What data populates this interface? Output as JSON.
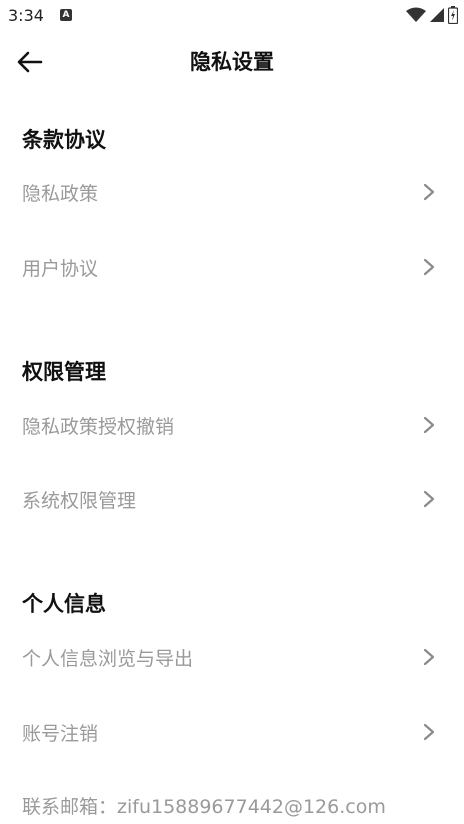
{
  "status_bar": {
    "time": "3:34",
    "notification_icon": "a-icon"
  },
  "header": {
    "title": "隐私设置",
    "back_icon": "arrow-left-icon"
  },
  "sections": [
    {
      "title": "条款协议",
      "items": [
        {
          "label": "隐私政策"
        },
        {
          "label": "用户协议"
        }
      ]
    },
    {
      "title": "权限管理",
      "items": [
        {
          "label": "隐私政策授权撤销"
        },
        {
          "label": "系统权限管理"
        }
      ]
    },
    {
      "title": "个人信息",
      "items": [
        {
          "label": "个人信息浏览与导出"
        },
        {
          "label": "账号注销"
        }
      ]
    }
  ],
  "contact": {
    "text": "联系邮箱：zifu15889677442@126.com"
  },
  "colors": {
    "title": "#111111",
    "item_text": "#9a9a9a",
    "chevron": "#8a8a8a"
  }
}
